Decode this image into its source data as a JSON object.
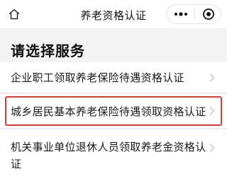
{
  "header": {
    "title": "养老资格认证",
    "home_icon": "home-icon",
    "more_icon": "more-dots-icon",
    "close_icon": "target-close-icon"
  },
  "main": {
    "section_title": "请选择服务",
    "items": [
      {
        "label": "企业职工领取养老保险待遇资格认证",
        "icon": "chevron-right-icon"
      },
      {
        "label": "城乡居民基本养老保险待遇领取资格认证",
        "icon": "chevron-right-icon",
        "highlighted": true
      },
      {
        "label": "机关事业单位退休人员领取养老金资格认证",
        "icon": "chevron-right-icon"
      }
    ]
  },
  "colors": {
    "highlight_border": "#e53935",
    "page_background": "#f3f3f3",
    "chevron": "#c4c4c4"
  }
}
